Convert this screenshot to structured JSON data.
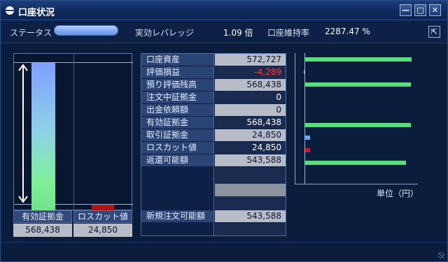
{
  "window": {
    "title": "口座状況",
    "minimize_label": "—",
    "maximize_label": "□",
    "close_label": "✕"
  },
  "status_row": {
    "status_label": "ステータス",
    "leverage_label": "実効レバレッジ",
    "leverage_value": "1.09 倍",
    "maintenance_label": "口座維持率",
    "maintenance_value": "2287.47 %",
    "export_icon": "⇱"
  },
  "gauge": {
    "left_label": "有効証拠金",
    "left_value": "568,438",
    "right_label": "ロスカット値",
    "right_value": "24,850",
    "left_fill": 1.0,
    "right_fill": 0.0437,
    "left_color": "#6fe28a",
    "right_color": "#b21414"
  },
  "table": {
    "rows": [
      {
        "label": "口座資産",
        "value": "572,727",
        "style": "light"
      },
      {
        "label": "評価損益",
        "value": "-4,289",
        "style": "dark-neg"
      },
      {
        "label": "預り評価残高",
        "value": "568,438",
        "style": "light"
      },
      {
        "label": "注文中証拠金",
        "value": "0",
        "style": "dark"
      },
      {
        "label": "出金依頼額",
        "value": "0",
        "style": "light"
      },
      {
        "label": "有効証拠金",
        "value": "568,438",
        "style": "dark"
      },
      {
        "label": "取引証拠金",
        "value": "24,850",
        "style": "light"
      },
      {
        "label": "ロスカット値",
        "value": "24,850",
        "style": "dark"
      },
      {
        "label": "返還可能額",
        "value": "543,588",
        "style": "light"
      }
    ],
    "new_order_label": "新規注文可能額",
    "new_order_value": "543,588"
  },
  "bar_chart": {
    "unit_label": "単位（円）",
    "bars": [
      {
        "name": "口座資産",
        "value": 572727,
        "color": "#57e07a"
      },
      {
        "name": "評価損益",
        "value": -4289,
        "color": "#7fa8ff"
      },
      {
        "name": "預り評価残高",
        "value": 568438,
        "color": "#57e07a"
      },
      {
        "name": "有効証拠金",
        "value": 568438,
        "color": "#57e07a"
      },
      {
        "name": "取引証拠金",
        "value": 24850,
        "color": "#6aa8ee"
      },
      {
        "name": "ロスカット値",
        "value": 24850,
        "color": "#c41c1c"
      },
      {
        "name": "返還可能額",
        "value": 543588,
        "color": "#57e07a"
      }
    ],
    "max": 572727
  }
}
